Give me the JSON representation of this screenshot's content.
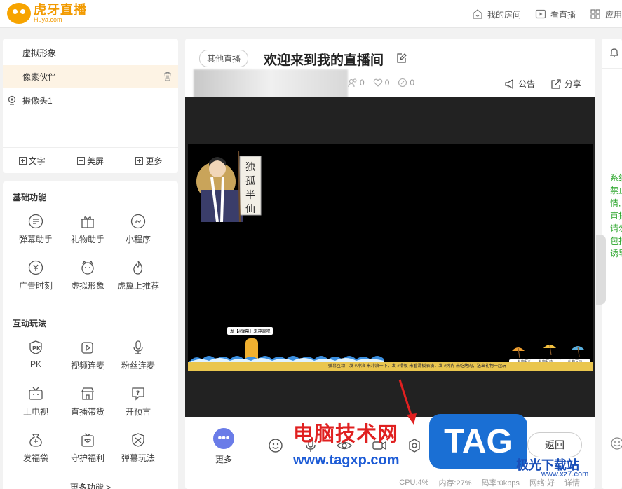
{
  "brand": {
    "name": "虎牙直播",
    "sub": "Huya.com",
    "color": "#f7a400"
  },
  "topnav": [
    {
      "label": "我的房间",
      "icon": "home-icon"
    },
    {
      "label": "看直播",
      "icon": "play-icon"
    },
    {
      "label": "应用",
      "icon": "grid-icon"
    }
  ],
  "scenes": [
    {
      "label": "虚拟形象"
    },
    {
      "label": "像素伙伴"
    },
    {
      "label": "摄像头1"
    }
  ],
  "scene_add": {
    "text": "文字",
    "screen": "美屏",
    "more": "更多"
  },
  "basic": {
    "title": "基础功能",
    "tools": [
      {
        "label": "弹幕助手",
        "icon": "danmaku-icon"
      },
      {
        "label": "礼物助手",
        "icon": "gift-icon"
      },
      {
        "label": "小程序",
        "icon": "miniapp-icon"
      },
      {
        "label": "广告时刻",
        "icon": "ad-icon"
      },
      {
        "label": "虚拟形象",
        "icon": "avatar-icon"
      },
      {
        "label": "虎翼上推荐",
        "icon": "flame-icon"
      }
    ]
  },
  "interactive": {
    "title": "互动玩法",
    "tools": [
      {
        "label": "PK",
        "icon": "pk-icon"
      },
      {
        "label": "视频连麦",
        "icon": "video-link-icon"
      },
      {
        "label": "粉丝连麦",
        "icon": "mic-icon"
      },
      {
        "label": "上电视",
        "icon": "tv-icon"
      },
      {
        "label": "直播带货",
        "icon": "shop-icon"
      },
      {
        "label": "开预言",
        "icon": "predict-icon"
      },
      {
        "label": "发福袋",
        "icon": "lucky-bag-icon"
      },
      {
        "label": "守护福利",
        "icon": "guard-gift-icon"
      },
      {
        "label": "弹幕玩法",
        "icon": "danmaku-game-icon"
      }
    ],
    "more_label": "更多功能 >"
  },
  "room": {
    "tag": "其他直播",
    "title": "欢迎来到我的直播间",
    "stats": [
      "0",
      "0",
      "0"
    ],
    "announce": "公告",
    "share": "分享"
  },
  "stage": {
    "speech": "发【#弹幕】来冲浪吧",
    "banner": "弹幕互动：发 #冲浪 来冲浪一下，发 #滑板 来看滑板表演，发 #烤肉 来吃烤肉，送出礼物一起玩",
    "gifts": [
      "礼物互动",
      "礼物互动",
      "礼物互动"
    ],
    "scroll_text": "独孤半仙"
  },
  "controls": {
    "more": "更多",
    "return": "返回"
  },
  "status": {
    "cpu": "CPU:4%",
    "mem": "内存:27%",
    "bitrate": "码率:0kbps",
    "network": "网络:好",
    "detail": "详情"
  },
  "chat": {
    "lines": [
      "系统",
      "禁止",
      "情,",
      "直播",
      "请勿",
      "包括",
      "诱导"
    ],
    "color": "#2aa52a"
  },
  "watermark": {
    "cn": "电脑技术网",
    "url": "www.tagxp.com",
    "tag": "TAG",
    "site": "极光下载站",
    "site_url": "www.xz7.com"
  }
}
